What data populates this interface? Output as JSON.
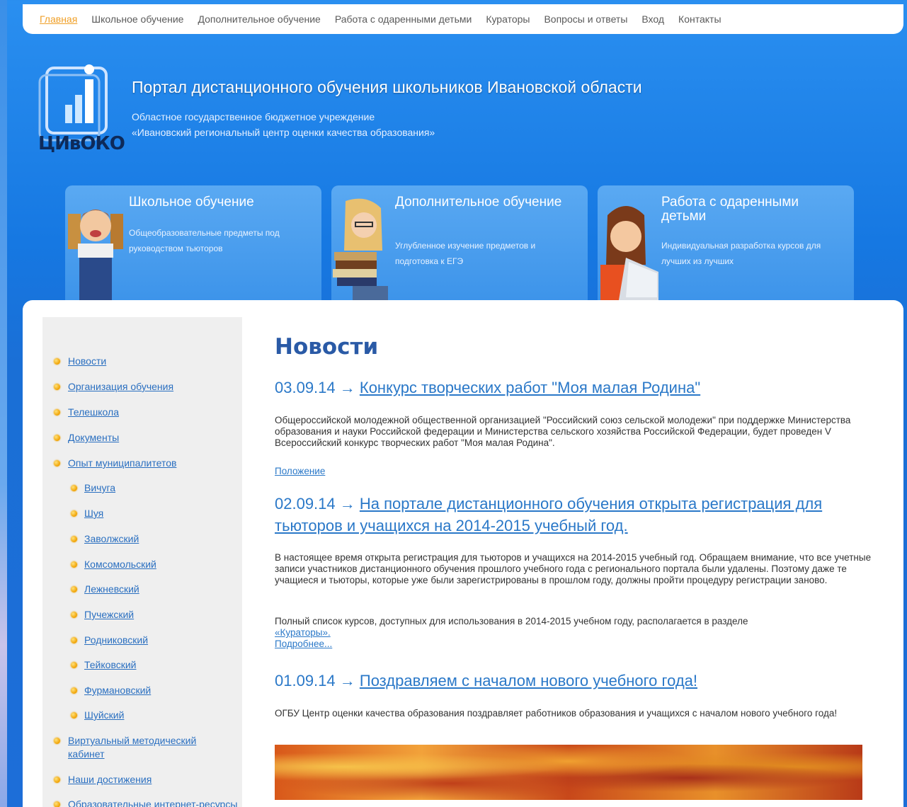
{
  "nav": {
    "items": [
      {
        "label": "Главная",
        "active": true
      },
      {
        "label": "Школьное обучение"
      },
      {
        "label": "Дополнительное обучение"
      },
      {
        "label": "Работа с одаренными детьми"
      },
      {
        "label": "Кураторы"
      },
      {
        "label": "Вопросы и ответы"
      },
      {
        "label": "Вход"
      },
      {
        "label": "Контакты"
      }
    ]
  },
  "header": {
    "logo_text": "ЦИвОКО",
    "title": "Портал дистанционного обучения школьников Ивановской области",
    "sub1": "Областное государственное бюджетное учреждение",
    "sub2": "«Ивановский региональный центр оценки качества образования»"
  },
  "promos": [
    {
      "title": "Школьное обучение",
      "desc": "Общеобразовательные предметы под руководством тьюторов"
    },
    {
      "title": "Дополнительное обучение",
      "desc": "Углубленное изучение предметов и подготовка к ЕГЭ"
    },
    {
      "title": "Работа с одаренными детьми",
      "desc": "Индивидуальная разработка курсов для лучших из лучших"
    }
  ],
  "sidebar": {
    "items": [
      "Новости",
      "Организация обучения",
      "Телешкола",
      "Документы",
      "Опыт муниципалитетов",
      "Вичуга",
      "Шуя",
      "Заволжский",
      "Комсомольский",
      "Лежневский",
      "Пучежский",
      "Родниковский",
      "Тейковский",
      "Фурмановский",
      "Шуйский",
      "Виртуальный методический кабинет",
      "Наши достижения",
      "Образовательные интернет-ресурсы"
    ]
  },
  "main": {
    "title": "Новости",
    "news": [
      {
        "date": "03.09.14 →",
        "headline": "Конкурс творческих работ \"Моя малая Родина\"",
        "body": "Общероссийской молодежной общественной организацией \"Российский союз сельской молодежи\" при поддержке Министерства образования и науки Российской федерации и Министерства сельского хозяйства Российской Федерации, будет проведен V Всероссийский конкурс творческих работ \"Моя малая Родина\".",
        "link": "Положение"
      },
      {
        "date": "02.09.14 →",
        "headline": "На портале дистанционного обучения открыта регистрация для тьюторов и учащихся на 2014-2015 учебный год.",
        "body": "В настоящее время открыта регистрация для тьюторов и учащихся на 2014-2015 учебный год. Обращаем внимание, что все учетные записи участников дистанционного обучения прошлого учебного года с регионального портала были удалены. Поэтому даже те учащиеся и тьюторы, которые уже были зарегистрированы в прошлом году, должны пройти процедуру регистрации заново.",
        "body2": "Полный список курсов, доступных для использования в 2014-2015 учебном году, располагается в разделе",
        "inline_link": "«Кураторы».",
        "link": "Подробнее..."
      },
      {
        "date": "01.09.14 →",
        "headline": "Поздравляем с началом нового учебного года!",
        "body": "ОГБУ Центр оценки качества образования поздравляет работников образования и учащихся с началом нового учебного года!"
      }
    ]
  },
  "colors": {
    "accent": "#2a78c8",
    "nav_active": "#f0a028",
    "bg_blue": "#1a74dc"
  }
}
